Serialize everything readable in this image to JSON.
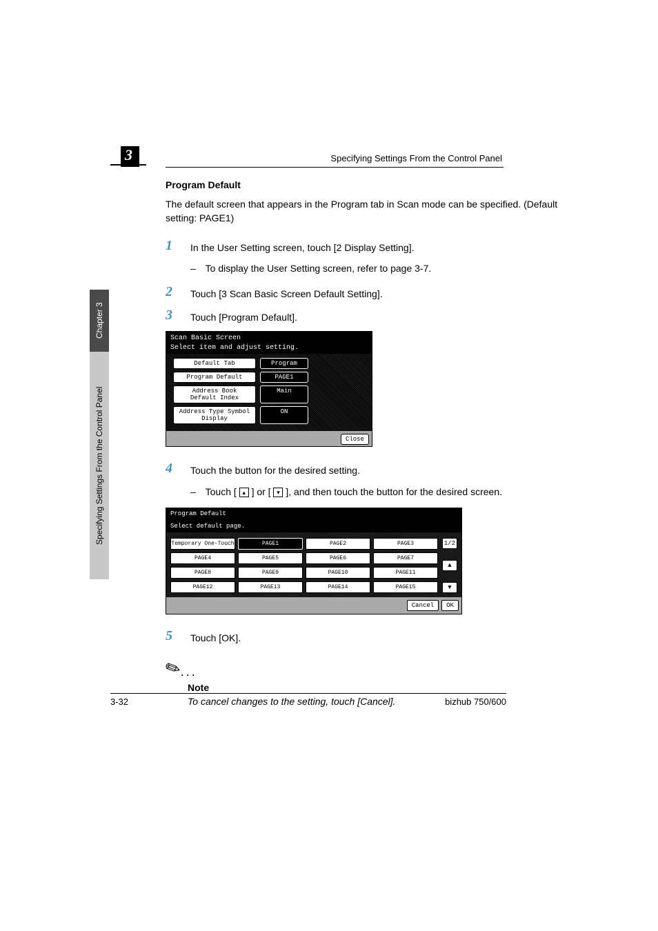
{
  "header": {
    "running_head": "Specifying Settings From the Control Panel",
    "chapter_number": "3"
  },
  "sidebar": {
    "chapter_tab": "Chapter 3",
    "section_tab": "Specifying Settings From the Control Panel"
  },
  "section": {
    "title": "Program Default",
    "intro": "The default screen that appears in the Program tab in Scan mode can be specified. (Default setting: PAGE1)"
  },
  "steps": {
    "s1": {
      "num": "1",
      "text": "In the User Setting screen, touch [2 Display Setting].",
      "sub_dash": "–",
      "sub": "To display the User Setting screen, refer to page 3-7."
    },
    "s2": {
      "num": "2",
      "text": "Touch [3 Scan Basic Screen Default Setting]."
    },
    "s3": {
      "num": "3",
      "text": "Touch [Program Default]."
    },
    "s4": {
      "num": "4",
      "text": "Touch the button for the desired setting.",
      "sub_dash": "–",
      "sub_before": "Touch [ ",
      "sub_mid": " ] or [ ",
      "sub_after": " ], and then touch the button for the desired screen."
    },
    "s5": {
      "num": "5",
      "text": "Touch [OK]."
    }
  },
  "screenshot1": {
    "title1": "Scan Basic Screen",
    "title2": "Select item and adjust setting.",
    "rows": [
      {
        "label": "Default Tab",
        "value": "Program"
      },
      {
        "label": "Program Default",
        "value": "PAGE1"
      },
      {
        "label": "Address Book Default Index",
        "value": "Main"
      },
      {
        "label": "Address Type Symbol Display",
        "value": "ON"
      }
    ],
    "close": "Close"
  },
  "screenshot2": {
    "title1": "Program Default",
    "title2": "Select default page.",
    "buttons": [
      "Temporary One-Touch",
      "PAGE1",
      "PAGE2",
      "PAGE3",
      "PAGE4",
      "PAGE5",
      "PAGE6",
      "PAGE7",
      "PAGE8",
      "PAGE9",
      "PAGE10",
      "PAGE11",
      "PAGE12",
      "PAGE13",
      "PAGE14",
      "PAGE15"
    ],
    "scroll_indicator": "1/2",
    "up": "▲",
    "down": "▼",
    "cancel": "Cancel",
    "ok": "OK"
  },
  "icons": {
    "up_arrow": "▴",
    "down_arrow": "▾"
  },
  "note": {
    "label": "Note",
    "body": "To cancel changes to the setting, touch [Cancel]."
  },
  "footer": {
    "page": "3-32",
    "model": "bizhub 750/600"
  }
}
